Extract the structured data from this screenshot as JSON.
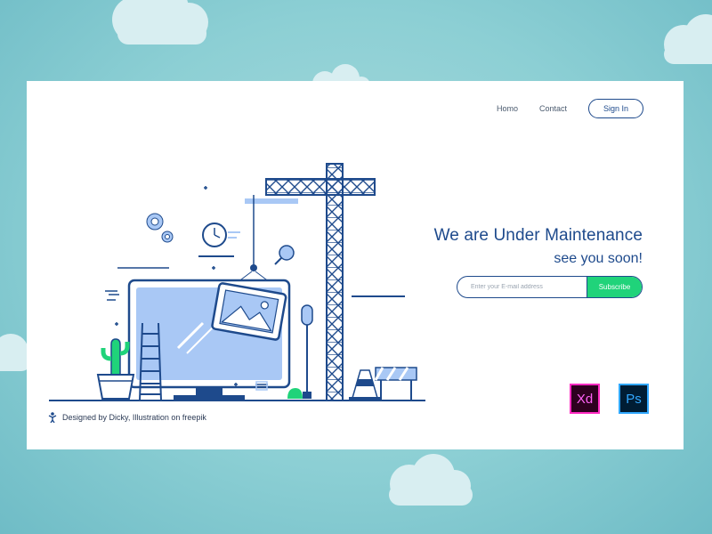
{
  "nav": {
    "home_label": "Homo",
    "contact_label": "Contact",
    "signin_label": "Sign In"
  },
  "hero": {
    "headline": "We are Under Maintenance",
    "subline": "see you soon!"
  },
  "subscribe": {
    "placeholder": "Enter your E-mail address",
    "button_label": "Subscribe"
  },
  "footer": {
    "credit": "Designed by Dicky, Illustration on freepik"
  },
  "app_icons": {
    "xd_label": "Xd",
    "ps_label": "Ps"
  },
  "colors": {
    "accent": "#1e4a8c",
    "button_green": "#20d37a",
    "illustration_blue": "#a9c8f5",
    "background": "#8ccfd4"
  }
}
